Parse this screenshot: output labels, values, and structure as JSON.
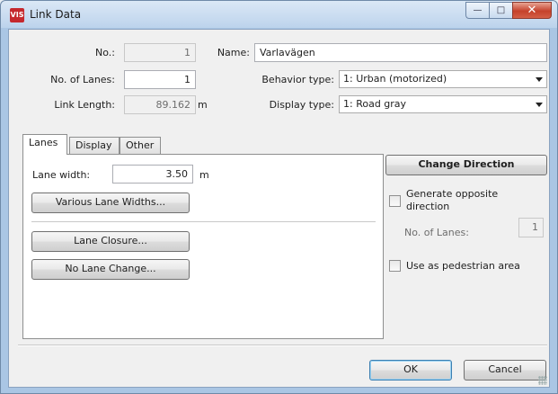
{
  "window": {
    "title": "Link Data",
    "icon_text": "VIS",
    "controls": {
      "minimize": "—",
      "maximize": "□",
      "close": "✕"
    }
  },
  "header": {
    "no": {
      "label": "No.:",
      "value": "1"
    },
    "name": {
      "label": "Name:",
      "value": "Varlavägen"
    },
    "lanes": {
      "label": "No. of Lanes:",
      "value": "1"
    },
    "behavior": {
      "label": "Behavior type:",
      "value": "1: Urban (motorized)"
    },
    "length": {
      "label": "Link Length:",
      "value": "89.162",
      "unit": "m"
    },
    "display": {
      "label": "Display type:",
      "value": "1: Road gray"
    }
  },
  "tabs": [
    {
      "label": "Lanes",
      "active": true
    },
    {
      "label": "Display",
      "active": false
    },
    {
      "label": "Other",
      "active": false
    }
  ],
  "lanes_tab": {
    "lane_width_label": "Lane width:",
    "lane_width_value": "3.50",
    "lane_width_unit": "m",
    "various_widths_button": "Various Lane Widths...",
    "lane_closure_button": "Lane Closure...",
    "no_lane_change_button": "No Lane Change..."
  },
  "right_panel": {
    "change_direction_button": "Change Direction",
    "generate_opposite_label": "Generate opposite direction",
    "generate_opposite_checked": false,
    "opposite_lanes_label": "No. of Lanes:",
    "opposite_lanes_value": "1",
    "pedestrian_label": "Use as pedestrian area",
    "pedestrian_checked": false
  },
  "footer": {
    "ok": "OK",
    "cancel": "Cancel"
  }
}
